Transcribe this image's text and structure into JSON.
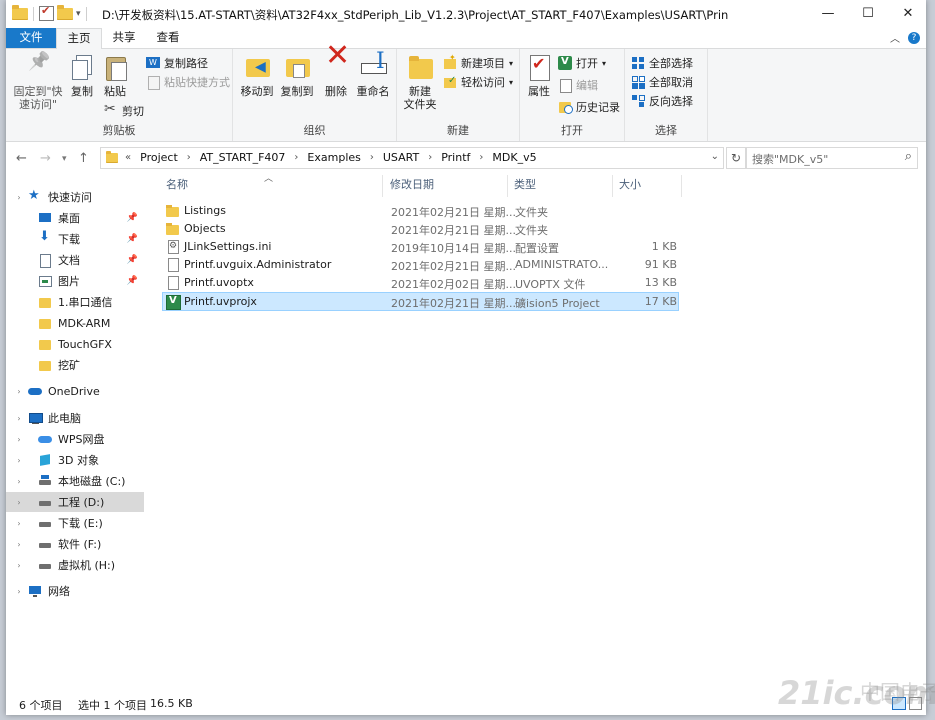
{
  "window": {
    "title": "D:\\开发板资料\\15.AT-START\\资料\\AT32F4xx_StdPeriph_Lib_V1.2.3\\Project\\AT_START_F407\\Examples\\USART\\Prin",
    "minimize": "—",
    "maximize": "☐",
    "close": "✕"
  },
  "tabs": {
    "file": "文件",
    "home": "主页",
    "share": "共享",
    "view": "查看"
  },
  "ribbon": {
    "clipboard": {
      "label": "剪贴板",
      "pin": "固定到\"快\n速访问\"",
      "copy": "复制",
      "paste": "粘贴",
      "copy_path": "复制路径",
      "paste_shortcut": "粘贴快捷方式",
      "cut": "剪切"
    },
    "organize": {
      "label": "组织",
      "move_to": "移动到",
      "copy_to": "复制到",
      "delete": "删除",
      "rename": "重命名"
    },
    "new": {
      "label": "新建",
      "new_folder": "新建\n文件夹",
      "new_item": "新建项目",
      "easy_access": "轻松访问"
    },
    "open": {
      "label": "打开",
      "properties": "属性",
      "open": "打开",
      "edit": "编辑",
      "history": "历史记录"
    },
    "select": {
      "label": "选择",
      "select_all": "全部选择",
      "select_none": "全部取消",
      "invert": "反向选择"
    }
  },
  "address": {
    "crumbs": [
      "Project",
      "AT_START_F407",
      "Examples",
      "USART",
      "Printf",
      "MDK_v5"
    ],
    "search_placeholder": "搜索\"MDK_v5\""
  },
  "nav": {
    "quick_access": "快速访问",
    "desktop": "桌面",
    "downloads": "下载",
    "documents": "文档",
    "pictures": "图片",
    "folder1": "1.串口通信",
    "folder2": "MDK-ARM",
    "folder3": "TouchGFX",
    "folder4": "挖矿",
    "onedrive": "OneDrive",
    "this_pc": "此电脑",
    "wps": "WPS网盘",
    "objects3d": "3D 对象",
    "drive_c": "本地磁盘 (C:)",
    "drive_d": "工程 (D:)",
    "drive_e": "下载 (E:)",
    "drive_f": "软件 (F:)",
    "drive_h": "虚拟机 (H:)",
    "network": "网络"
  },
  "columns": {
    "name": "名称",
    "date": "修改日期",
    "type": "类型",
    "size": "大小"
  },
  "files": [
    {
      "name": "Listings",
      "date": "2021年02月21日 星期...",
      "type": "文件夹",
      "size": ""
    },
    {
      "name": "Objects",
      "date": "2021年02月21日 星期...",
      "type": "文件夹",
      "size": ""
    },
    {
      "name": "JLinkSettings.ini",
      "date": "2019年10月14日 星期...",
      "type": "配置设置",
      "size": "1 KB"
    },
    {
      "name": "Printf.uvguix.Administrator",
      "date": "2021年02月21日 星期...",
      "type": "ADMINISTRATO...",
      "size": "91 KB"
    },
    {
      "name": "Printf.uvoptx",
      "date": "2021年02月02日 星期...",
      "type": "UVOPTX 文件",
      "size": "13 KB"
    },
    {
      "name": "Printf.uvprojx",
      "date": "2021年02月21日 星期...",
      "type": "礦ision5 Project",
      "size": "17 KB"
    }
  ],
  "status": {
    "count": "6 个项目",
    "selected": "选中 1 个项目",
    "size": "16.5 KB"
  },
  "watermark": "21ic.com",
  "watermark2": "中国电子网"
}
